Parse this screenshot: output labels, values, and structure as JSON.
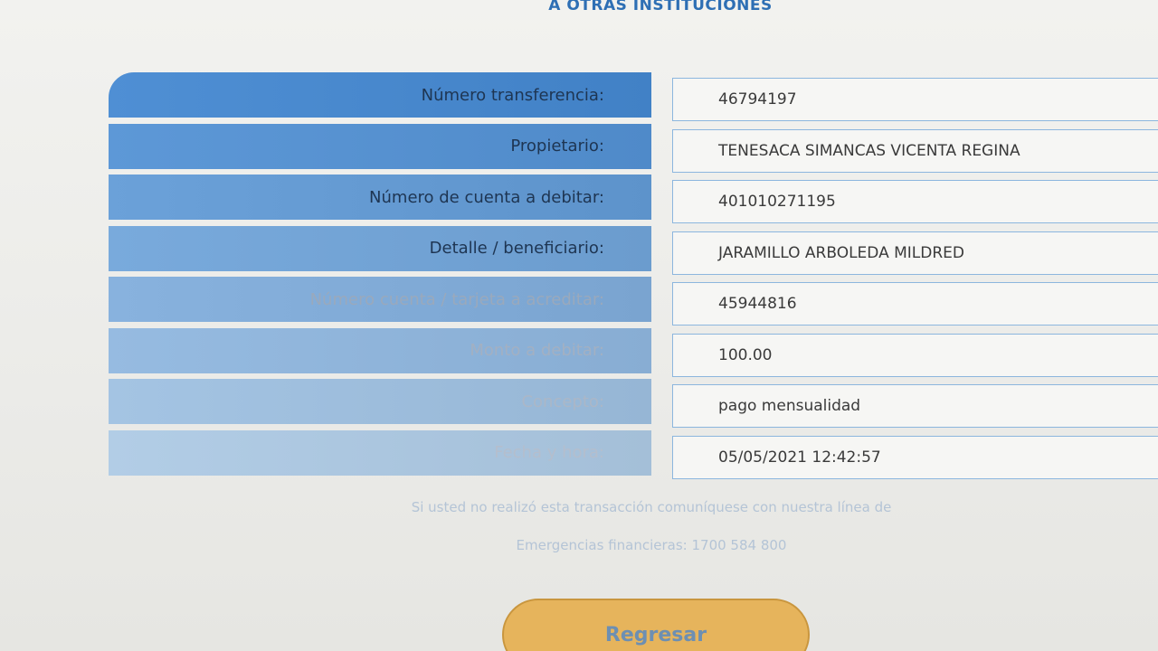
{
  "header": {
    "title": "A OTRAS INSTITUCIONES"
  },
  "rows": [
    {
      "label": "Número transferencia:",
      "value": "46794197"
    },
    {
      "label": "Propietario:",
      "value": "TENESACA SIMANCAS VICENTA REGINA"
    },
    {
      "label": "Número de cuenta a debitar:",
      "value": "401010271195"
    },
    {
      "label": "Detalle / beneficiario:",
      "value": "JARAMILLO ARBOLEDA MILDRED"
    },
    {
      "label": "Número cuenta / tarjeta a acreditar:",
      "value": "45944816"
    },
    {
      "label": "Monto a debitar:",
      "value": "100.00"
    },
    {
      "label": "Concepto:",
      "value": "pago mensualidad"
    },
    {
      "label": "Fecha y hora:",
      "value": "05/05/2021 12:42:57"
    }
  ],
  "notice": {
    "line1": "Si usted no realizó esta transacción comuníquese con nuestra línea de",
    "line2": "Emergencias financieras: 1700 584 800"
  },
  "actions": {
    "back_label": "Regresar"
  },
  "colors": {
    "label_bg_top": "#4f8fd4",
    "label_bg_bottom": "#b2cde6",
    "value_border": "#8cb6de",
    "button_bg": "#e6b45c"
  }
}
